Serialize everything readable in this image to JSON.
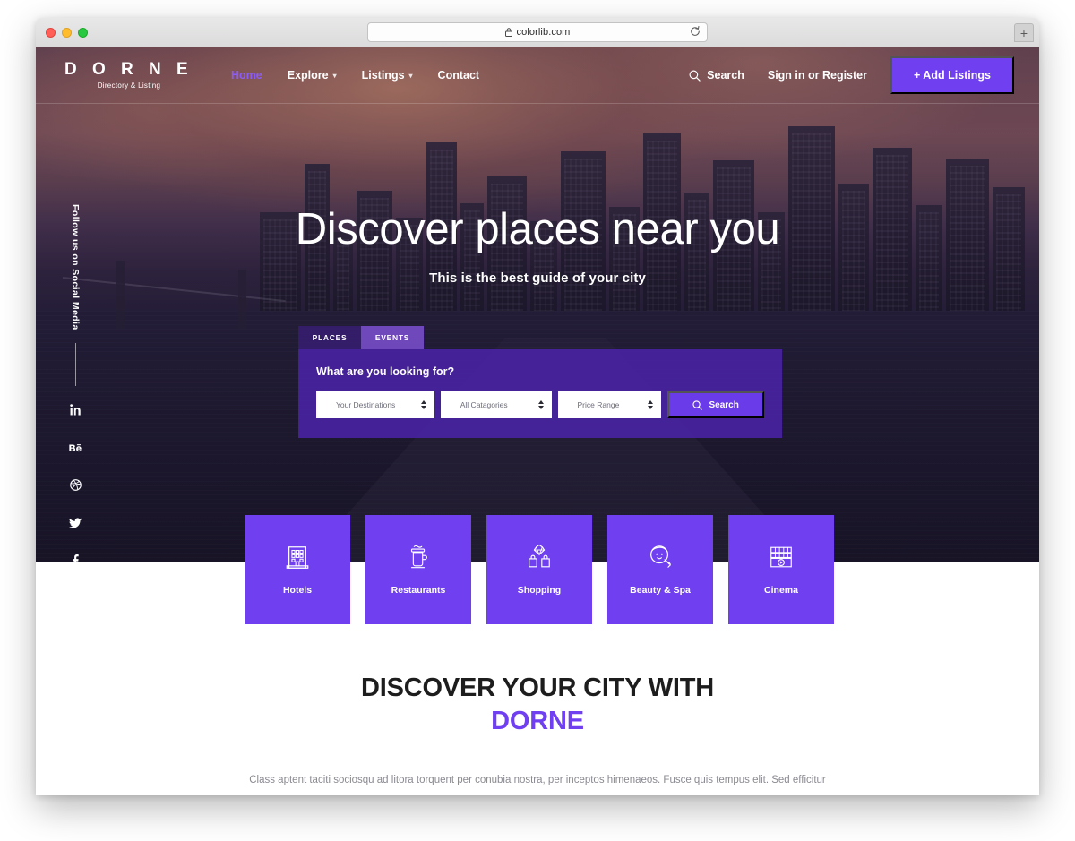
{
  "browser": {
    "url": "colorlib.com",
    "lock_icon": "lock-icon",
    "reload_icon": "reload-icon",
    "new_tab_label": "+",
    "traffic_lights": [
      "close",
      "minimize",
      "maximize"
    ]
  },
  "nav": {
    "logo_main": "D O R N E",
    "logo_sub": "Directory & Listing",
    "menu": [
      {
        "label": "Home",
        "active": true,
        "caret": ""
      },
      {
        "label": "Explore",
        "active": false,
        "caret": "⌄"
      },
      {
        "label": "Listings",
        "active": false,
        "caret": "⌄"
      },
      {
        "label": "Contact",
        "active": false,
        "caret": ""
      }
    ],
    "search_label": "Search",
    "search_icon": "search-icon",
    "signin_label": "Sign in or Register",
    "add_listings_label": "+ Add Listings"
  },
  "social": {
    "label": "Follow us on Social Media",
    "icons": [
      {
        "name": "linkedin-icon",
        "glyph": "in"
      },
      {
        "name": "behance-icon",
        "glyph": "Bē"
      },
      {
        "name": "dribbble-icon",
        "glyph": "⊛"
      },
      {
        "name": "twitter-icon",
        "glyph": "twitter"
      },
      {
        "name": "facebook-icon",
        "glyph": "f"
      }
    ]
  },
  "hero": {
    "title": "Discover places near you",
    "subtitle": "This is the best guide of your city"
  },
  "search_panel": {
    "tabs": [
      {
        "label": "PLACES",
        "active": false
      },
      {
        "label": "EVENTS",
        "active": true
      }
    ],
    "heading": "What are you looking for?",
    "fields": [
      {
        "name": "destinations-select",
        "value": "Your Destinations"
      },
      {
        "name": "categories-select",
        "value": "All Catagories"
      },
      {
        "name": "price-select",
        "value": "Price Range"
      }
    ],
    "search_button": "Search",
    "search_button_icon": "search-icon"
  },
  "categories": [
    {
      "label": "Hotels",
      "icon": "hotel-building-icon"
    },
    {
      "label": "Restaurants",
      "icon": "coffee-cup-icon"
    },
    {
      "label": "Shopping",
      "icon": "shopping-bags-icon"
    },
    {
      "label": "Beauty & Spa",
      "icon": "beauty-face-icon"
    },
    {
      "label": "Cinema",
      "icon": "film-clapper-icon"
    }
  ],
  "section": {
    "heading_line1": "DISCOVER YOUR CITY WITH",
    "heading_line2": "DORNE",
    "paragraph": "Class aptent taciti sociosqu ad litora torquent per conubia nostra, per inceptos himenaeos. Fusce quis tempus elit. Sed efficitur tortor neque, vitae aliquet urna varius sit amet. Ut rhoncus, nunc nec tincidunt volutpat, ex libero."
  },
  "colors": {
    "brand_purple": "#7040f0",
    "nav_active": "#8b5cf6",
    "panel_purple": "#4a23a8",
    "search_btn": "#6a3be8",
    "heading_dark": "#1d1d1d",
    "body_gray": "#8a8a92"
  }
}
